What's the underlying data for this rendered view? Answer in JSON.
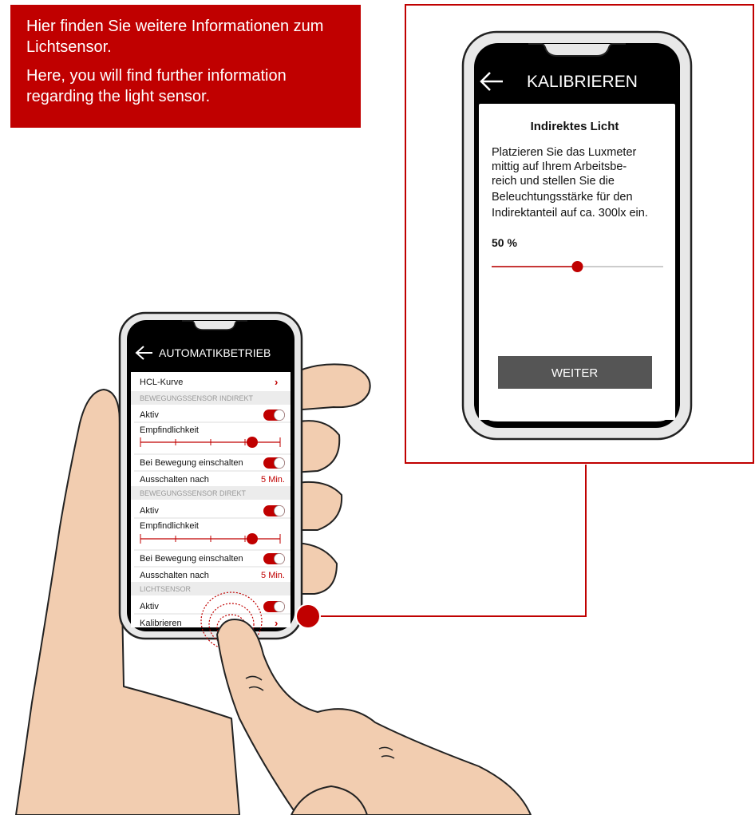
{
  "callout": {
    "german": "Hier finden Sie weitere Informationen zum Lichtsensor.",
    "english": "Here, you will find further information regarding the light sensor."
  },
  "calibration": {
    "title": "KALIBRIEREN",
    "heading": "Indirektes Licht",
    "body_lines": [
      "Platzieren Sie das Luxmeter",
      "mittig auf Ihrem Arbeitsbe-",
      "reich und stellen Sie die",
      "Beleuchtungsstärke für den",
      "Indirektanteil auf ca. 300lx ein."
    ],
    "percent_label": "50 %",
    "slider_value": 0.5,
    "button_label": "WEITER"
  },
  "auto_mode": {
    "title": "AUTOMATIKBETRIEB",
    "hcl_label": "HCL-Kurve",
    "section_indirect": "BEWEGUNGSSENSOR INDIREKT",
    "section_direct": "BEWEGUNGSSENSOR DIREKT",
    "section_light": "LICHTSENSOR",
    "active_label": "Aktiv",
    "sensitivity_label": "Empfindlichkeit",
    "on_motion_label": "Bei Bewegung einschalten",
    "switch_off_label": "Ausschalten nach",
    "switch_off_value": "5 Min.",
    "calibrate_label": "Kalibrieren",
    "sensitivity_level": 0.8
  },
  "colors": {
    "accent": "#c00000",
    "skin": "#f2cdb0",
    "outline": "#222222",
    "button": "#555555"
  }
}
